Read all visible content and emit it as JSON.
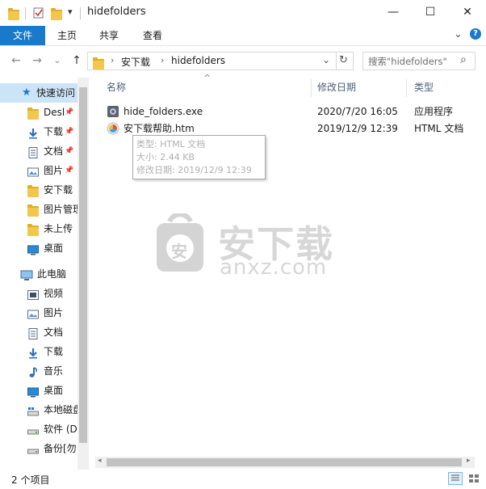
{
  "window": {
    "title": "hidefolders",
    "minimize_glyph": "—",
    "maximize_glyph": "☐",
    "close_glyph": "✕"
  },
  "quick_access_toolbar": {
    "dropdown_glyph": "▾"
  },
  "ribbon": {
    "tabs": [
      {
        "label": "文件"
      },
      {
        "label": "主页"
      },
      {
        "label": "共享"
      },
      {
        "label": "查看"
      }
    ],
    "expand_glyph": "⌄",
    "help_glyph": "?"
  },
  "address_bar": {
    "back_glyph": "←",
    "forward_glyph": "→",
    "recent_glyph": "⌄",
    "up_glyph": "↑",
    "breadcrumb": [
      "安下载",
      "hidefolders"
    ],
    "dropdown_glyph": "⌄",
    "refresh_glyph": "↻",
    "search_placeholder": "搜索\"hidefolders\"",
    "search_glyph": "⌕"
  },
  "sidebar": {
    "quick_access": {
      "label": "快速访问",
      "items": [
        {
          "label": "Desl",
          "icon": "desktop-folder-icon",
          "pinned": true
        },
        {
          "label": "下载",
          "icon": "download-icon",
          "pinned": true
        },
        {
          "label": "文档",
          "icon": "document-icon",
          "pinned": true
        },
        {
          "label": "图片",
          "icon": "picture-icon",
          "pinned": true
        },
        {
          "label": "安下载",
          "icon": "folder-icon",
          "pinned": false
        },
        {
          "label": "图片管理",
          "icon": "folder-icon",
          "pinned": false
        },
        {
          "label": "未上传",
          "icon": "folder-icon",
          "pinned": false
        },
        {
          "label": "桌面",
          "icon": "desktop-icon",
          "pinned": false
        }
      ]
    },
    "this_pc": {
      "label": "此电脑",
      "items": [
        {
          "label": "视频",
          "icon": "video-icon"
        },
        {
          "label": "图片",
          "icon": "picture-icon"
        },
        {
          "label": "文档",
          "icon": "document-icon"
        },
        {
          "label": "下载",
          "icon": "download-icon"
        },
        {
          "label": "音乐",
          "icon": "music-icon"
        },
        {
          "label": "桌面",
          "icon": "desktop-icon"
        },
        {
          "label": "本地磁盘",
          "icon": "drive-icon"
        },
        {
          "label": "软件 (D",
          "icon": "drive-icon"
        },
        {
          "label": "备份[勿",
          "icon": "drive-icon"
        }
      ]
    }
  },
  "file_list": {
    "columns": [
      {
        "label": "名称"
      },
      {
        "label": "修改日期"
      },
      {
        "label": "类型"
      }
    ],
    "rows": [
      {
        "name": "hide_folders.exe",
        "date": "2020/7/20 16:05",
        "type": "应用程序",
        "icon": "exe-icon"
      },
      {
        "name": "安下载帮助.htm",
        "date": "2019/12/9 12:39",
        "type": "HTML 文档",
        "icon": "htm-icon"
      }
    ],
    "tooltip": {
      "type_line": "类型: HTML 文档",
      "size_line": "大小: 2.44 KB",
      "date_line": "修改日期: 2019/12/9 12:39"
    }
  },
  "watermark": {
    "text": "安下载",
    "subtext": "anxz.com",
    "logo_char": "安"
  },
  "status_bar": {
    "item_count": "2 个项目"
  },
  "colors": {
    "accent": "#1979ca",
    "folder": "#f3c74b",
    "header_text": "#4c607a"
  }
}
